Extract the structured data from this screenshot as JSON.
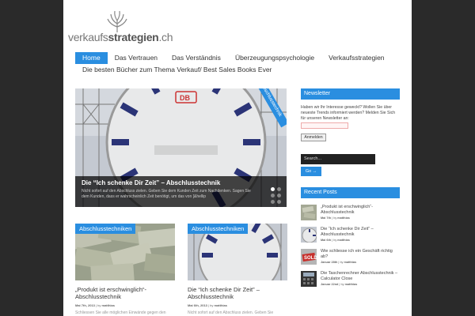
{
  "site": {
    "logo_text_plain": "verkaufs",
    "logo_text_bold": "strategien",
    "logo_text_tld": ".ch"
  },
  "nav": {
    "row1": [
      "Home",
      "Das Vertrauen",
      "Das Verständnis",
      "Überzeugungspsychologie",
      "Verkaufsstrategien"
    ],
    "row2": [
      "Die besten Bücher zum Thema Verkauf/ Best Sales Books Ever"
    ]
  },
  "slider": {
    "ribbon": "Abschlusstechnik",
    "title": "Die “Ich schenke Dir Zeit” – Abschlusstechnik",
    "excerpt": "Nicht sofort auf den Abschluss zielen. Geben Sie dem Kunden Zeit zum Nachdenken. Sagen Sie dem Kunden, dass er wahrscheinlich Zeit benötigt, um das von [&hellip"
  },
  "cards": [
    {
      "label": "Abschlusstechniken",
      "title": "„Produkt ist erschwinglich“-Abschlusstechnik",
      "date": "Mai 7th, 2013",
      "author": "matthias",
      "excerpt": "Schliessen Sie alle möglichen Einwände gegen den"
    },
    {
      "label": "Abschlusstechniken",
      "title": "Die “Ich schenke Dir Zeit” – Abschlusstechnik",
      "date": "Mai 6th, 2013",
      "author": "matthias",
      "excerpt": "Nicht sofort auf den Abschluss zielen. Geben Sie"
    }
  ],
  "sidebar": {
    "newsletter_title": "Newsletter",
    "newsletter_text": "Haben wir Ihr Interesse geweckt? Wollen Sie über neueste Trends informiert werden? Melden Sie Sich für unseren Newsletter an:",
    "newsletter_button": "Anmelden",
    "search_placeholder": "Search...",
    "go_label": "Go →",
    "recent_title": "Recent Posts",
    "recent": [
      {
        "title": "„Produkt ist erschwinglich“-Abschlusstechnik",
        "date": "Mai 7th",
        "author": "matthias"
      },
      {
        "title": "Die “Ich schenke Dir Zeit” – Abschlusstechnik",
        "date": "Mai 6th",
        "author": "matthias"
      },
      {
        "title": "Wie schliesse ich ein Geschäft richtig ab?",
        "date": "Januar 28th",
        "author": "matthias"
      },
      {
        "title": "Die Taschenrechner Abschlusstechnik – Calculator Close",
        "date": "Januar 22nd",
        "author": "matthias"
      }
    ]
  },
  "colors": {
    "accent": "#2a8ee0",
    "background": "#2a2a2a",
    "page": "#ffffff"
  }
}
